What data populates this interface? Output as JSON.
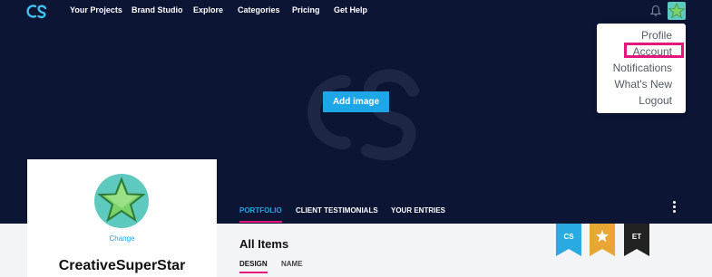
{
  "nav": {
    "logo_text": "CS",
    "items": [
      "Your Projects",
      "Brand Studio",
      "Explore",
      "Categories",
      "Pricing",
      "Get Help"
    ]
  },
  "banner": {
    "add_image_label": "Add image"
  },
  "dropdown": {
    "items": [
      "Profile",
      "Account",
      "Notifications",
      "What's New",
      "Logout"
    ],
    "highlighted": "Account"
  },
  "tabs": {
    "items": [
      "PORTFOLIO",
      "CLIENT TESTIMONIALS",
      "YOUR ENTRIES"
    ],
    "active": "PORTFOLIO"
  },
  "profile": {
    "change_label": "Change",
    "username": "CreativeSuperStar"
  },
  "content": {
    "heading": "All Items",
    "subtabs": [
      "DESIGN",
      "NAME"
    ],
    "active_subtab": "DESIGN"
  },
  "badges": [
    {
      "label": "CS",
      "color": "#29abe2",
      "icon": "cs-logo-icon"
    },
    {
      "label": "",
      "color": "#e8a634",
      "icon": "star-icon"
    },
    {
      "label": "ET",
      "color": "#222222",
      "icon": "et-text"
    }
  ],
  "colors": {
    "nav_bg": "#0d1535",
    "accent_blue": "#1ea7e6",
    "accent_pink": "#e3177e",
    "teal": "#5ec9be"
  }
}
